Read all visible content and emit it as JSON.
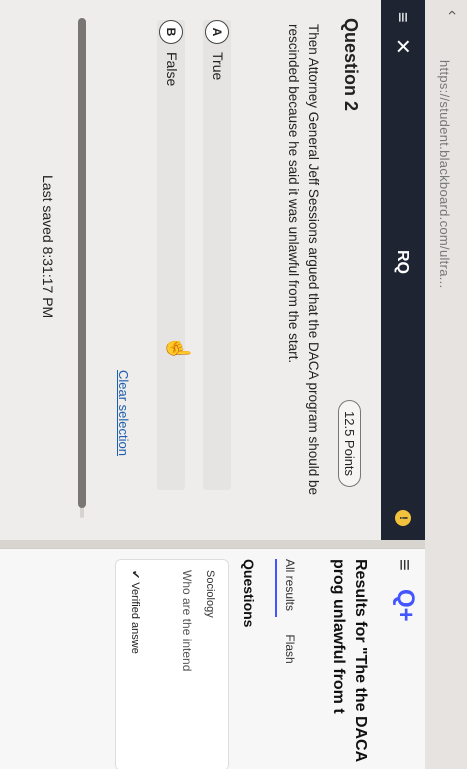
{
  "browser": {
    "url": "https://student.blackboard.com/ultra/...",
    "url_display": "https://student.blackboard.com/ultra..."
  },
  "quiz": {
    "header_title": "RQ",
    "question_title": "Question 2",
    "points": "12.5 Points",
    "question_text": "Then Attorney General Jeff Sessions argued that the DACA program should be rescinded because he said it was unlawful from the start.",
    "options": [
      {
        "letter": "A",
        "label": "True"
      },
      {
        "letter": "B",
        "label": "False"
      }
    ],
    "clear_selection": "Clear selection",
    "last_saved": "Last saved 8:31:17 PM"
  },
  "right_panel": {
    "heading": "Results for \"The the DACA prog unlawful from t",
    "tabs": [
      "All results",
      "Flash"
    ],
    "questions_label": "Questions",
    "card_subject": "Sociology",
    "card_question": "Who are the intend",
    "verified": "Verified answe"
  },
  "colors": {
    "header_bg": "#1e2432",
    "accent": "#4255ff",
    "link": "#1b5fb0"
  }
}
